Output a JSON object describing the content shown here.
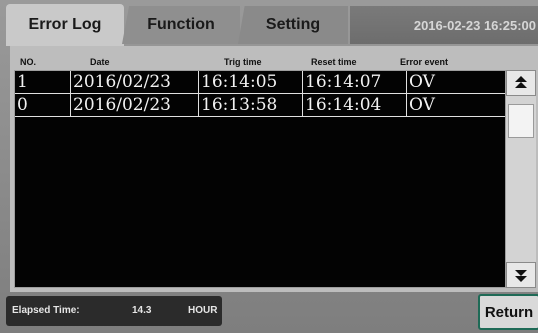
{
  "tabs": [
    {
      "label": "Error Log"
    },
    {
      "label": "Function"
    },
    {
      "label": "Setting"
    }
  ],
  "datetime": "2016-02-23 16:25:00",
  "table": {
    "columns": [
      "NO.",
      "Date",
      "Trig time",
      "Reset time",
      "Error event"
    ],
    "rows": [
      {
        "no": "1",
        "date": "2016/02/23",
        "trig": "16:14:05",
        "reset": "16:14:07",
        "event": "OV"
      },
      {
        "no": "0",
        "date": "2016/02/23",
        "trig": "16:13:58",
        "reset": "16:14:04",
        "event": "OV"
      }
    ]
  },
  "scroll": {
    "up_icon": "double-up-arrow",
    "down_icon": "double-down-arrow"
  },
  "elapsed": {
    "label": "Elapsed Time:",
    "value": "14.3",
    "unit": "HOUR"
  },
  "return_label": "Return"
}
